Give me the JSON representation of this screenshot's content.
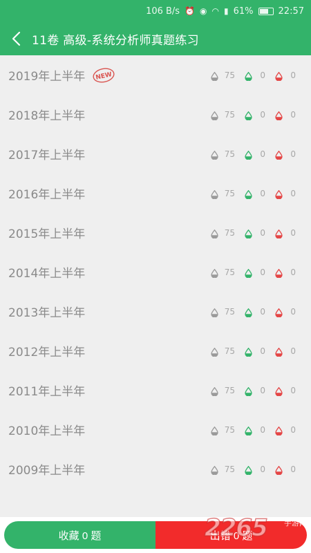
{
  "status_bar": {
    "speed": "106 B/s",
    "battery": "61%",
    "time": "22:57"
  },
  "header": {
    "title": "11卷 高级-系统分析师真题练习"
  },
  "colors": {
    "accent": "#33b36a",
    "error": "#f22b2b",
    "text_muted": "#8a8a8a",
    "drop_gray": "#9a9a9a",
    "drop_green": "#33b36a",
    "drop_red": "#e44545"
  },
  "icons": {
    "back": "chevron-left-icon",
    "total": "water-drop-gray-icon",
    "correct": "water-drop-green-icon",
    "wrong": "water-drop-red-icon",
    "new": "new-stamp-icon"
  },
  "papers": [
    {
      "title": "2019年上半年",
      "total": "75",
      "correct": "0",
      "wrong": "0",
      "is_new": true
    },
    {
      "title": "2018年上半年",
      "total": "75",
      "correct": "0",
      "wrong": "0",
      "is_new": false
    },
    {
      "title": "2017年上半年",
      "total": "75",
      "correct": "0",
      "wrong": "0",
      "is_new": false
    },
    {
      "title": "2016年上半年",
      "total": "75",
      "correct": "0",
      "wrong": "0",
      "is_new": false
    },
    {
      "title": "2015年上半年",
      "total": "75",
      "correct": "0",
      "wrong": "0",
      "is_new": false
    },
    {
      "title": "2014年上半年",
      "total": "75",
      "correct": "0",
      "wrong": "0",
      "is_new": false
    },
    {
      "title": "2013年上半年",
      "total": "75",
      "correct": "0",
      "wrong": "0",
      "is_new": false
    },
    {
      "title": "2012年上半年",
      "total": "75",
      "correct": "0",
      "wrong": "0",
      "is_new": false
    },
    {
      "title": "2011年上半年",
      "total": "75",
      "correct": "0",
      "wrong": "0",
      "is_new": false
    },
    {
      "title": "2010年上半年",
      "total": "75",
      "correct": "0",
      "wrong": "0",
      "is_new": false
    },
    {
      "title": "2009年上半年",
      "total": "75",
      "correct": "0",
      "wrong": "0",
      "is_new": false
    }
  ],
  "bottom_bar": {
    "favorites_label": "收藏 0 题",
    "errors_label": "出错 0 题"
  },
  "watermark": {
    "number": "2265",
    "text": "手游网"
  }
}
